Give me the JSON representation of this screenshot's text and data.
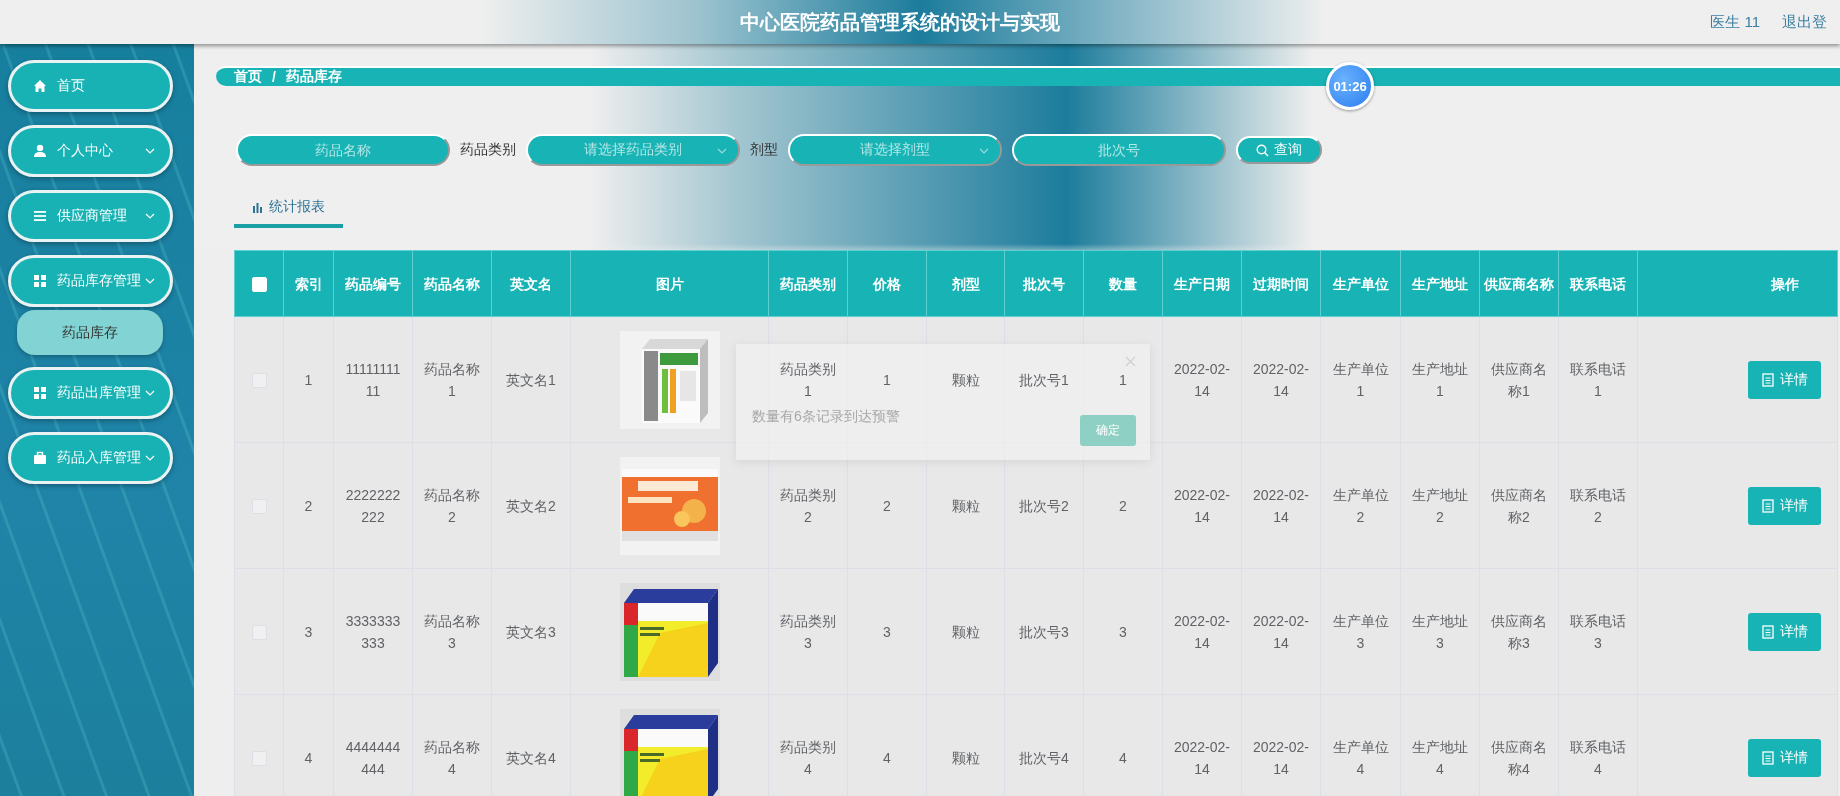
{
  "header": {
    "title": "中心医院药品管理系统的设计与实现",
    "user": "医生 11",
    "logout": "退出登"
  },
  "sidebar": {
    "items": [
      {
        "label": "首页",
        "kind": "link"
      },
      {
        "label": "个人中心",
        "kind": "submenu"
      },
      {
        "label": "供应商管理",
        "kind": "submenu"
      },
      {
        "label": "药品库存管理",
        "kind": "submenu",
        "children": [
          {
            "label": "药品库存",
            "selected": true
          }
        ]
      },
      {
        "label": "药品出库管理",
        "kind": "submenu"
      },
      {
        "label": "药品入库管理",
        "kind": "submenu"
      }
    ]
  },
  "breadcrumb": {
    "items": [
      "首页",
      "药品库存"
    ],
    "separator": "/"
  },
  "timer": "01:26",
  "search": {
    "fields": [
      {
        "kind": "input",
        "placeholder": "药品名称"
      },
      {
        "kind": "select",
        "label": "药品类别",
        "placeholder": "请选择药品类别"
      },
      {
        "kind": "select",
        "label": "剂型",
        "placeholder": "请选择剂型"
      },
      {
        "kind": "input",
        "placeholder": "批次号"
      }
    ],
    "button": "查询"
  },
  "tabs": [
    {
      "label": "统计报表",
      "selected": true
    }
  ],
  "table": {
    "all_checked": false,
    "columns": [
      "索引",
      "药品编号",
      "药品名称",
      "英文名",
      "图片",
      "药品类别",
      "价格",
      "剂型",
      "批次号",
      "数量",
      "生产日期",
      "过期时间",
      "生产单位",
      "生产地址",
      "供应商名称",
      "联系电话",
      "操作"
    ],
    "rows": [
      {
        "checked": false,
        "cells": [
          "1",
          "1111111111",
          "药品名称1",
          "英文名1",
          null,
          "药品类别1",
          "1",
          "颗粒",
          "批次号1",
          "1",
          "2022-02-14",
          "2022-02-14",
          "生产单位1",
          "生产地址1",
          "供应商名称1",
          "联系电话1"
        ],
        "action": "详情"
      },
      {
        "checked": false,
        "cells": [
          "2",
          "2222222222",
          "药品名称2",
          "英文名2",
          null,
          "药品类别2",
          "2",
          "颗粒",
          "批次号2",
          "2",
          "2022-02-14",
          "2022-02-14",
          "生产单位2",
          "生产地址2",
          "供应商名称2",
          "联系电话2"
        ],
        "action": "详情"
      },
      {
        "checked": false,
        "cells": [
          "3",
          "3333333333",
          "药品名称3",
          "英文名3",
          null,
          "药品类别3",
          "3",
          "颗粒",
          "批次号3",
          "3",
          "2022-02-14",
          "2022-02-14",
          "生产单位3",
          "生产地址3",
          "供应商名称3",
          "联系电话3"
        ],
        "action": "详情"
      },
      {
        "checked": false,
        "cells": [
          "4",
          "4444444444",
          "药品名称4",
          "英文名4",
          null,
          "药品类别4",
          "4",
          "颗粒",
          "批次号4",
          "4",
          "2022-02-14",
          "2022-02-14",
          "生产单位4",
          "生产地址4",
          "供应商名称4",
          "联系电话4"
        ],
        "action": "详情"
      }
    ]
  },
  "dialog": {
    "message": "数量有6条记录到达预警",
    "button": "确定"
  }
}
